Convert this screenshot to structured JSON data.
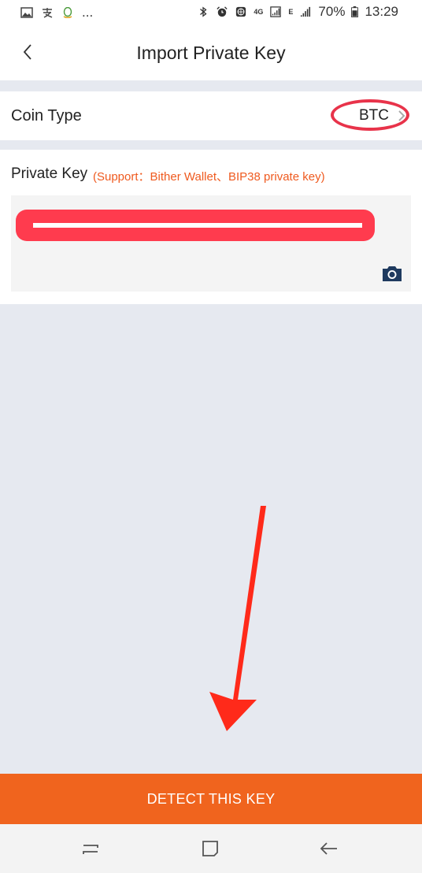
{
  "status_bar": {
    "left_icons": [
      "image-icon",
      "alipay-icon",
      "qq-icon"
    ],
    "ellipsis": "...",
    "network_label": "4G",
    "network_e": "E",
    "battery": "70%",
    "time": "13:29"
  },
  "header": {
    "title": "Import Private Key",
    "back_icon": "chevron-left-icon"
  },
  "coin_type": {
    "label": "Coin Type",
    "value": "BTC"
  },
  "private_key": {
    "label": "Private Key",
    "support": "(Support：Bither Wallet、BIP38 private key)",
    "camera_icon": "camera-icon"
  },
  "actions": {
    "detect_label": "DETECT THIS KEY"
  },
  "colors": {
    "accent": "#f0641e",
    "annotation_red": "#ff3b4e",
    "background": "#e6e9f0"
  }
}
